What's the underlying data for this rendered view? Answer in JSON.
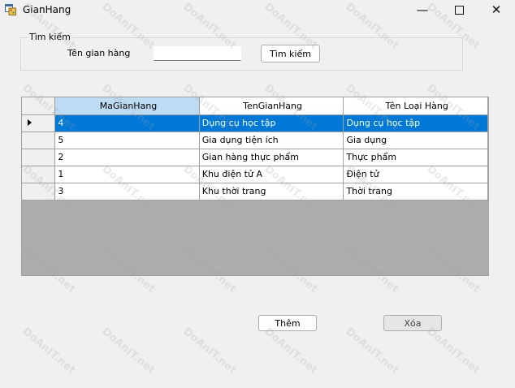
{
  "window": {
    "title": "GianHang",
    "minimize_glyph": "—",
    "close_glyph": "✕"
  },
  "search": {
    "group_title": "Tìm kiếm",
    "label": "Tên gian hàng",
    "value": "",
    "placeholder": "",
    "button_label": "Tìm kiếm"
  },
  "grid": {
    "columns": [
      "MaGianHang",
      "TenGianHang",
      "Tên Loại Hàng"
    ],
    "sorted_column": "MaGianHang",
    "selected_row": 0,
    "rows": [
      [
        "4",
        "Dụng cụ học tập",
        "Dụng cụ học tập"
      ],
      [
        "5",
        "Gia dụng tiện ích",
        "Gia dụng"
      ],
      [
        "2",
        "Gian hàng thực phẩm",
        "Thực phẩm"
      ],
      [
        "1",
        "Khu điện tử A",
        "Điện tử"
      ],
      [
        "3",
        "Khu thời trang",
        "Thời trang"
      ]
    ]
  },
  "actions": {
    "add_label": "Thêm",
    "delete_label": "Xóa"
  },
  "watermark": {
    "text": "DoAnIT.net"
  },
  "colors": {
    "selection": "#0078d7",
    "sorted_header": "#bcdcf4",
    "grid_background": "#adadad",
    "window_background": "#f0f0f0"
  },
  "icons": {
    "app": "form-icon",
    "row_selector": "triangle-right-icon"
  }
}
